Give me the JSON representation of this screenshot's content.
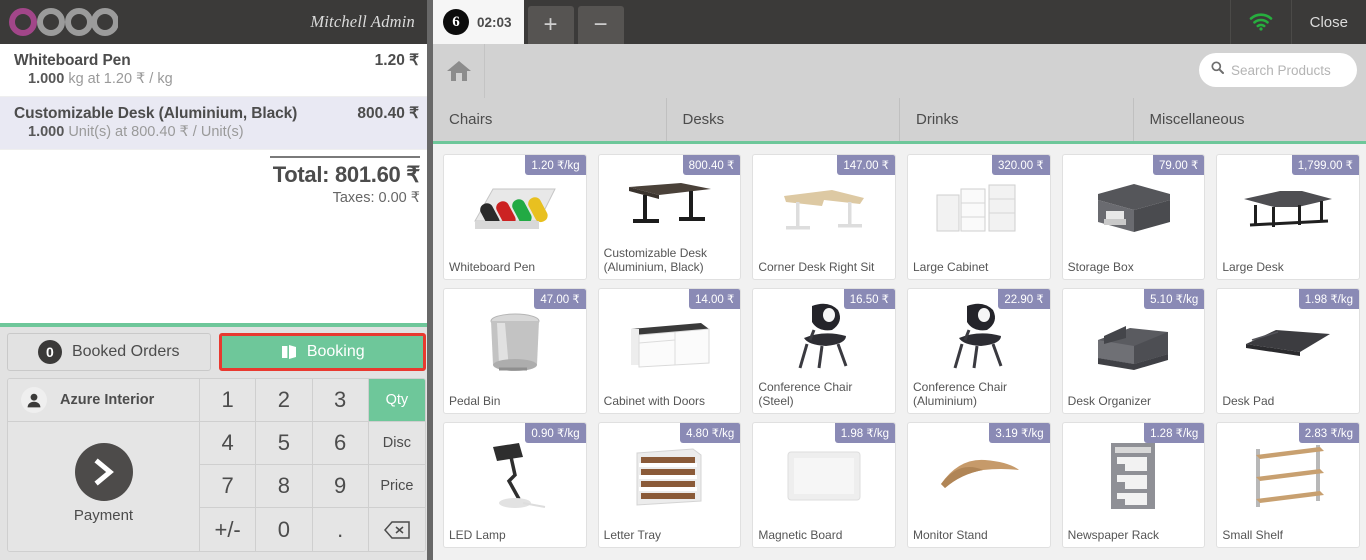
{
  "left": {
    "logo_alt": "odoo",
    "user": "Mitchell Admin",
    "orderlines": [
      {
        "name": "Whiteboard Pen",
        "price": "1.20 ₹",
        "qty": "1.000",
        "detail": "kg at 1.20 ₹ / kg",
        "selected": false
      },
      {
        "name": "Customizable Desk (Aluminium, Black)",
        "price": "800.40 ₹",
        "qty": "1.000",
        "detail": "Unit(s) at 800.40 ₹ / Unit(s)",
        "selected": true
      }
    ],
    "summary": {
      "total": "Total: 801.60 ₹",
      "taxes": "Taxes: 0.00 ₹"
    },
    "booked_orders": {
      "count": "0",
      "label": "Booked Orders"
    },
    "booking": {
      "label": "Booking",
      "icon": "book-icon",
      "color": "#6ec79a",
      "highlight": "#e8392f"
    },
    "customer": {
      "name": "Azure Interior",
      "icon": "user-icon"
    },
    "payment": {
      "label": "Payment",
      "icon": "chevron-right-icon"
    },
    "numpad": {
      "keys": [
        "1",
        "2",
        "3",
        "Qty",
        "4",
        "5",
        "6",
        "Disc",
        "7",
        "8",
        "9",
        "Price",
        "+/-",
        "0",
        ".",
        "⌫"
      ],
      "active": "Qty"
    }
  },
  "top": {
    "order_tab": {
      "number": "6",
      "time": "02:03"
    },
    "add_label": "+",
    "remove_label": "−",
    "wifi_icon": "wifi-icon",
    "wifi_color": "#27ae3e",
    "close_label": "Close"
  },
  "search": {
    "home_icon": "home-icon",
    "icon": "search-icon",
    "placeholder": "Search Products",
    "value": ""
  },
  "categories": [
    "Chairs",
    "Desks",
    "Drinks",
    "Miscellaneous"
  ],
  "products": [
    {
      "name": "Whiteboard Pen",
      "price": "1.20 ₹/kg",
      "img": "whiteboard-pen"
    },
    {
      "name": "Customizable Desk (Aluminium, Black)",
      "price": "800.40 ₹",
      "img": "desk-dark"
    },
    {
      "name": "Corner Desk Right Sit",
      "price": "147.00 ₹",
      "img": "corner-desk"
    },
    {
      "name": "Large Cabinet",
      "price": "320.00 ₹",
      "img": "large-cabinet"
    },
    {
      "name": "Storage Box",
      "price": "79.00 ₹",
      "img": "storage-box"
    },
    {
      "name": "Large Desk",
      "price": "1,799.00 ₹",
      "img": "large-desk"
    },
    {
      "name": "Pedal Bin",
      "price": "47.00 ₹",
      "img": "pedal-bin"
    },
    {
      "name": "Cabinet with Doors",
      "price": "14.00 ₹",
      "img": "cabinet-doors"
    },
    {
      "name": "Conference Chair (Steel)",
      "price": "16.50 ₹",
      "img": "chair"
    },
    {
      "name": "Conference Chair (Aluminium)",
      "price": "22.90 ₹",
      "img": "chair"
    },
    {
      "name": "Desk Organizer",
      "price": "5.10 ₹/kg",
      "img": "desk-organizer"
    },
    {
      "name": "Desk Pad",
      "price": "1.98 ₹/kg",
      "img": "desk-pad"
    },
    {
      "name": "LED Lamp",
      "price": "0.90 ₹/kg",
      "img": "led-lamp"
    },
    {
      "name": "Letter Tray",
      "price": "4.80 ₹/kg",
      "img": "letter-tray"
    },
    {
      "name": "Magnetic Board",
      "price": "1.98 ₹/kg",
      "img": "magnetic-board"
    },
    {
      "name": "Monitor Stand",
      "price": "3.19 ₹/kg",
      "img": "monitor-stand"
    },
    {
      "name": "Newspaper Rack",
      "price": "1.28 ₹/kg",
      "img": "newspaper-rack"
    },
    {
      "name": "Small Shelf",
      "price": "2.83 ₹/kg",
      "img": "small-shelf"
    }
  ]
}
